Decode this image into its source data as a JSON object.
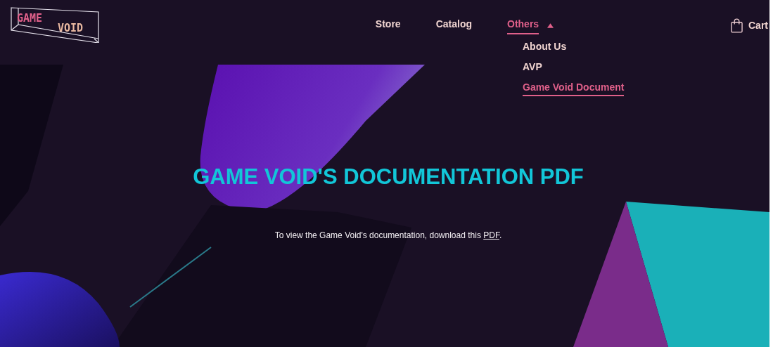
{
  "logo": {
    "word_1": "GAME",
    "word_2": "VOID"
  },
  "nav": [
    {
      "label": "Store",
      "selected": false
    },
    {
      "label": "Catalog",
      "selected": false
    },
    {
      "label": "Others",
      "selected": true,
      "expanded": true,
      "menu": [
        {
          "label": "About Us",
          "selected": false
        },
        {
          "label": "AVP",
          "selected": false
        },
        {
          "label": "Game Void Document",
          "selected": true
        }
      ]
    }
  ],
  "cart": {
    "label": "Cart"
  },
  "hero": {
    "title": "GAME VOID'S DOCUMENTATION PDF",
    "text": "To view the Game Void's documentation, download this ",
    "link": "PDF",
    "text_after": "."
  }
}
